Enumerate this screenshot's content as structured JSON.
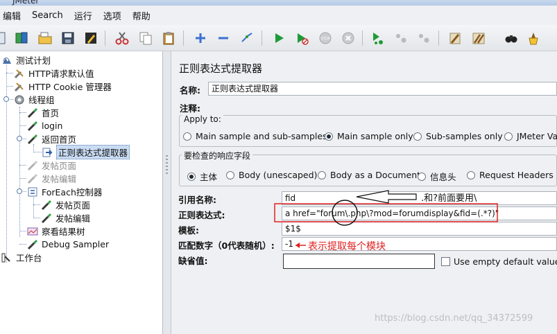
{
  "window": {
    "title": "JMeter"
  },
  "menu": [
    "编辑",
    "Search",
    "运行",
    "选项",
    "帮助"
  ],
  "toolbar": {
    "icons": [
      "open-icon",
      "templates-icon",
      "folder-open-icon",
      "save-icon",
      "edit-icon",
      "cut-icon",
      "copy-icon",
      "paste-icon",
      "expand-icon",
      "collapse-icon",
      "toggle-icon",
      "start-icon",
      "start-no-pause-icon",
      "stop-icon",
      "shutdown-icon",
      "remote-start-icon",
      "remote-stop-icon",
      "remote-shutdown-icon",
      "clear-icon",
      "clear-all-icon",
      "search-icon",
      "reset-search-icon"
    ]
  },
  "tree": {
    "items": [
      {
        "label": "测试计划",
        "icon": "test-plan-icon",
        "disabled": false
      },
      {
        "label": "HTTP请求默认值",
        "icon": "config-wrench-icon",
        "disabled": false
      },
      {
        "label": "HTTP Cookie 管理器",
        "icon": "config-wrench-icon",
        "disabled": false
      },
      {
        "label": "线程组",
        "icon": "gear-icon",
        "disabled": false
      },
      {
        "label": "首页",
        "icon": "sampler-pipette-icon",
        "disabled": false
      },
      {
        "label": "login",
        "icon": "sampler-pipette-icon",
        "disabled": false
      },
      {
        "label": "返回首页",
        "icon": "sampler-pipette-icon",
        "disabled": false
      },
      {
        "label": "正则表达式提取器",
        "icon": "post-processor-arrow-icon",
        "disabled": false,
        "selected": true
      },
      {
        "label": "发帖页面",
        "icon": "sampler-pipette-icon",
        "disabled": true
      },
      {
        "label": "发帖编辑",
        "icon": "sampler-pipette-icon",
        "disabled": true
      },
      {
        "label": "ForEach控制器",
        "icon": "controller-icon",
        "disabled": false
      },
      {
        "label": "发帖页面",
        "icon": "sampler-pipette-icon",
        "disabled": false
      },
      {
        "label": "发帖编辑",
        "icon": "sampler-pipette-icon",
        "disabled": false
      },
      {
        "label": "察看结果树",
        "icon": "listener-chart-icon",
        "disabled": false
      },
      {
        "label": "Debug Sampler",
        "icon": "sampler-pipette-icon",
        "disabled": false
      },
      {
        "label": "工作台",
        "icon": "workbench-icon",
        "disabled": false
      }
    ]
  },
  "panel": {
    "title": "正则表达式提取器",
    "name_label": "名称:",
    "name_value": "正则表达式提取器",
    "comment_label": "注释:",
    "comment_value": "",
    "apply_to": {
      "title": "Apply to:",
      "options": [
        "Main sample and sub-samples",
        "Main sample only",
        "Sub-samples only",
        "JMeter Var"
      ],
      "selected": "Main sample only"
    },
    "response_field": {
      "title": "要检查的响应字段",
      "options": [
        "主体",
        "Body (unescaped)",
        "Body as a Document",
        "信息头",
        "Request Headers"
      ],
      "selected": "主体"
    },
    "ref_name_label": "引用名称:",
    "ref_name_value": "fid",
    "regex_label": "正则表达式:",
    "regex_value": "a href=\"forum\\.php\\?mod=forumdisplay&fid=(.*?)\"",
    "template_label": "模板:",
    "template_value": "$1$",
    "match_no_label": "匹配数字（0代表随机）:",
    "match_no_value": "-1",
    "default_label": "缺省值:",
    "default_value": "",
    "use_empty_label": "Use empty default value"
  },
  "annotations": {
    "note_escape": ".和?前面要用\\",
    "note_match": "表示提取每个模块"
  },
  "watermark": "https://blog.csdn.net/qq_34372599",
  "colors": {
    "annotation_red": "#e02020",
    "selection": "#c9dcf3"
  }
}
